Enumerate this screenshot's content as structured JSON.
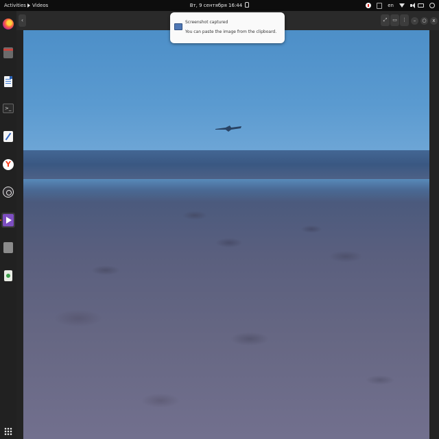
{
  "topbar": {
    "activities": "Activities",
    "app_name": "Videos",
    "clock": "Вт, 9 сентября  16:44",
    "language": "en"
  },
  "dock": {
    "items": [
      {
        "name": "firefox",
        "icon": "firefox-icon"
      },
      {
        "name": "files",
        "icon": "files-icon"
      },
      {
        "name": "libreoffice-writer",
        "icon": "writer-icon"
      },
      {
        "name": "terminal",
        "icon": "terminal-icon"
      },
      {
        "name": "text-editor",
        "icon": "text-editor-icon"
      },
      {
        "name": "yandex-browser",
        "icon": "yandex-icon"
      },
      {
        "name": "obs-studio",
        "icon": "obs-icon"
      },
      {
        "name": "videos",
        "icon": "videos-icon",
        "active": true
      },
      {
        "name": "unknown-app",
        "icon": "app-icon"
      },
      {
        "name": "trash",
        "icon": "trash-icon"
      }
    ],
    "show_apps_icon": "grid-icon",
    "terminal_glyph": ">_"
  },
  "player": {
    "back_glyph": "‹",
    "buttons": [
      "fullscreen",
      "screen",
      "menu",
      "minimize",
      "maximize",
      "close"
    ],
    "glyphs": {
      "fullscreen": "⤢",
      "screen": "▭",
      "menu": "⋮",
      "minimize": "–",
      "maximize": "○",
      "close": "x"
    }
  },
  "notification": {
    "title": "Screenshot captured",
    "body": "You can paste the image from the clipboard."
  },
  "colors": {
    "accent": "#e95420",
    "topbar": "#0d0d0d",
    "dock": "#212121",
    "sky": "#5a9ad0",
    "field": "#666783"
  }
}
